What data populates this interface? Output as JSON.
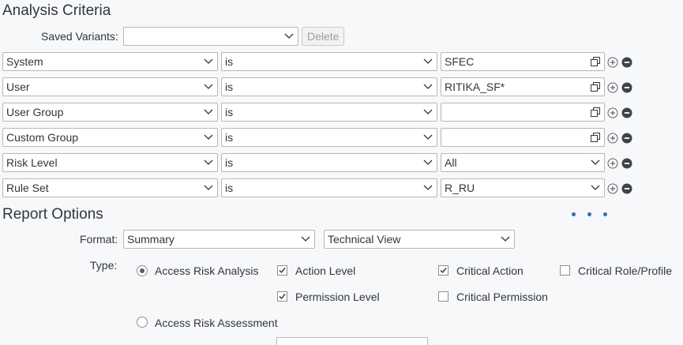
{
  "analysis": {
    "title": "Analysis Criteria",
    "saved_variants_label": "Saved Variants:",
    "saved_variants_value": "",
    "delete_label": "Delete",
    "rows": [
      {
        "field": "System",
        "operator": "is",
        "value": "SFEC",
        "value_type": "value-help"
      },
      {
        "field": "User",
        "operator": "is",
        "value": "RITIKA_SF*",
        "value_type": "value-help"
      },
      {
        "field": "User Group",
        "operator": "is",
        "value": "",
        "value_type": "value-help"
      },
      {
        "field": "Custom Group",
        "operator": "is",
        "value": "",
        "value_type": "value-help"
      },
      {
        "field": "Risk Level",
        "operator": "is",
        "value": "All",
        "value_type": "dropdown"
      },
      {
        "field": "Rule Set",
        "operator": "is",
        "value": "R_RU",
        "value_type": "dropdown"
      }
    ]
  },
  "report": {
    "title": "Report Options",
    "format_label": "Format:",
    "format_value": "Summary",
    "view_value": "Technical View",
    "type_label": "Type:",
    "radio_access_risk_analysis": "Access Risk Analysis",
    "radio_access_risk_assessment": "Access Risk Assessment",
    "action_level": "Action Level",
    "permission_level": "Permission Level",
    "critical_action": "Critical Action",
    "critical_permission": "Critical Permission",
    "critical_role_profile": "Critical Role/Profile"
  },
  "icons": {
    "add": "add-circle-icon",
    "remove": "remove-circle-icon",
    "value_help": "value-help-icon",
    "chevron": "chevron-down-icon",
    "more": "more-dots-icon"
  },
  "colors": {
    "accent": "#0a6ed1",
    "border": "#b4b7ba",
    "text": "#32363a",
    "background": "#f7f8fa"
  }
}
